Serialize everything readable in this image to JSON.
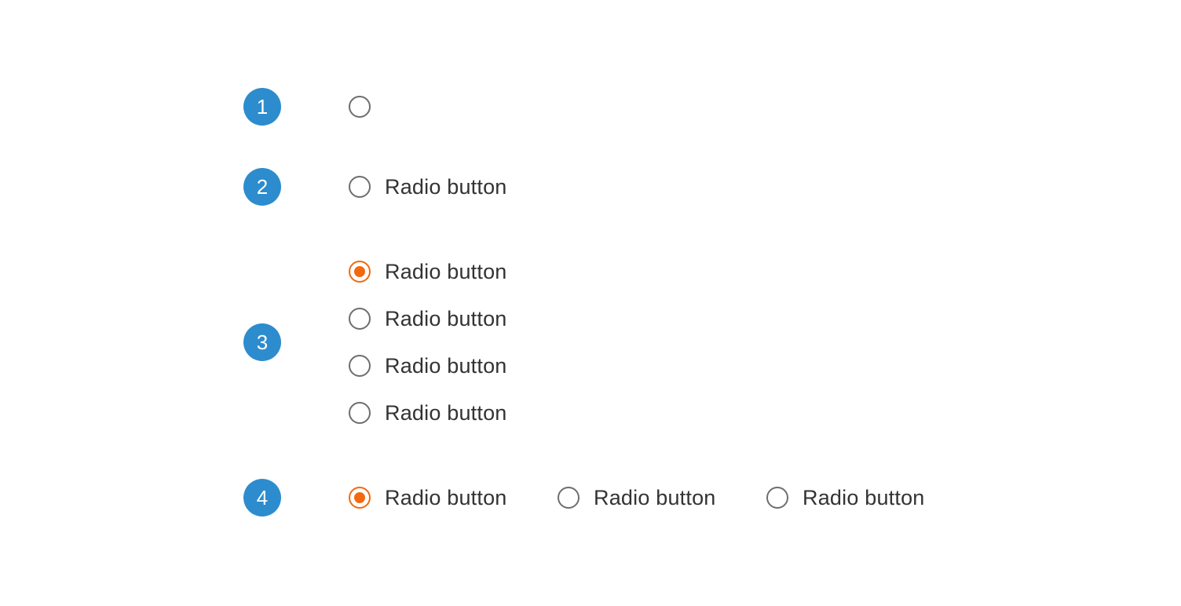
{
  "colors": {
    "badge": "#2d8ccd",
    "radio_checked": "#f26a10",
    "radio_unchecked": "#6e6e6e",
    "label_text": "#333333"
  },
  "badges": [
    "1",
    "2",
    "3",
    "4"
  ],
  "example1": {
    "radio": {
      "checked": false
    }
  },
  "example2": {
    "radio": {
      "label": "Radio button",
      "checked": false
    }
  },
  "example3": {
    "radios": [
      {
        "label": "Radio button",
        "checked": true
      },
      {
        "label": "Radio button",
        "checked": false
      },
      {
        "label": "Radio button",
        "checked": false
      },
      {
        "label": "Radio button",
        "checked": false
      }
    ]
  },
  "example4": {
    "radios": [
      {
        "label": "Radio button",
        "checked": true
      },
      {
        "label": "Radio button",
        "checked": false
      },
      {
        "label": "Radio button",
        "checked": false
      }
    ]
  }
}
